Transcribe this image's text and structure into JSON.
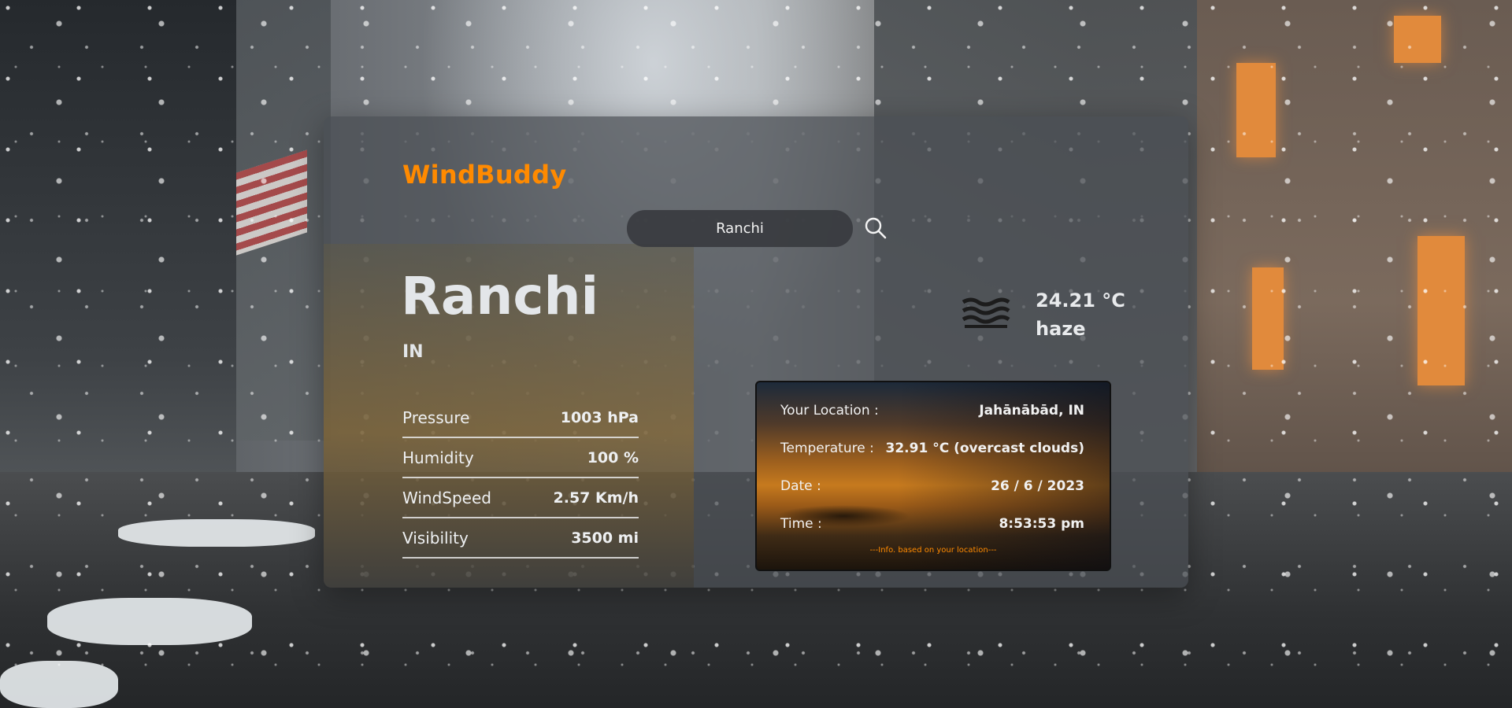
{
  "app": {
    "brand": "WindBuddy"
  },
  "search": {
    "value": "Ranchi"
  },
  "city": {
    "name": "Ranchi",
    "country": "IN"
  },
  "stats": [
    {
      "label": "Pressure",
      "value": "1003 hPa"
    },
    {
      "label": "Humidity",
      "value": "100 %"
    },
    {
      "label": "WindSpeed",
      "value": "2.57 Km/h"
    },
    {
      "label": "Visibility",
      "value": "3500 mi"
    }
  ],
  "current": {
    "icon": "haze-icon",
    "temperature": "24.21 °C",
    "condition": "haze"
  },
  "location_info": {
    "location_label": "Your Location :",
    "location_value": "Jahānābād, IN",
    "temperature_label": "Temperature :",
    "temperature_value": "32.91 °C (overcast clouds)",
    "date_label": "Date :",
    "date_value": "26 / 6 / 2023",
    "time_label": "Time :",
    "time_value": "8:53:53 pm",
    "note": "---Info. based on your location---"
  },
  "colors": {
    "brand": "#ff8a00",
    "card_bg": "#4a4e53",
    "text": "#e3e6e9"
  }
}
